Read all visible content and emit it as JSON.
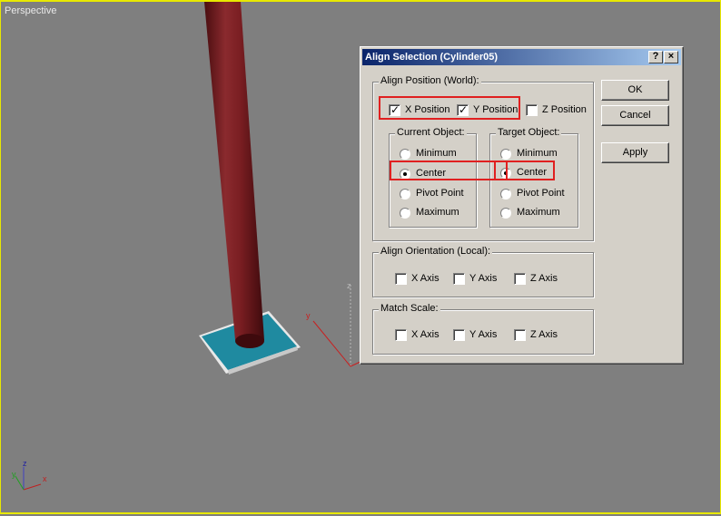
{
  "viewport": {
    "label": "Perspective"
  },
  "axis_labels": {
    "x": "x",
    "y": "y",
    "z": "z"
  },
  "dialog": {
    "title": "Align Selection (Cylinder05)",
    "help_glyph": "?",
    "close_glyph": "×",
    "align_position": {
      "label": "Align Position (World):",
      "x_position": {
        "label": "X Position",
        "checked": true
      },
      "y_position": {
        "label": "Y Position",
        "checked": true
      },
      "z_position": {
        "label": "Z Position",
        "checked": false
      },
      "current_object": {
        "label": "Current Object:",
        "options": [
          "Minimum",
          "Center",
          "Pivot Point",
          "Maximum"
        ],
        "selected": "Center"
      },
      "target_object": {
        "label": "Target Object:",
        "options": [
          "Minimum",
          "Center",
          "Pivot Point",
          "Maximum"
        ],
        "selected": "Center"
      }
    },
    "align_orientation": {
      "label": "Align Orientation (Local):",
      "x_axis": "X Axis",
      "y_axis": "Y Axis",
      "z_axis": "Z Axis"
    },
    "match_scale": {
      "label": "Match Scale:",
      "x_axis": "X Axis",
      "y_axis": "Y Axis",
      "z_axis": "Z Axis"
    },
    "buttons": {
      "ok": "OK",
      "cancel": "Cancel",
      "apply": "Apply"
    }
  },
  "colors": {
    "viewport_bg": "#7f7f7f",
    "viewport_border": "#e8e800",
    "cylinder": "#7a1e22",
    "plate": "#1f8aa0",
    "highlight": "#e02020"
  }
}
